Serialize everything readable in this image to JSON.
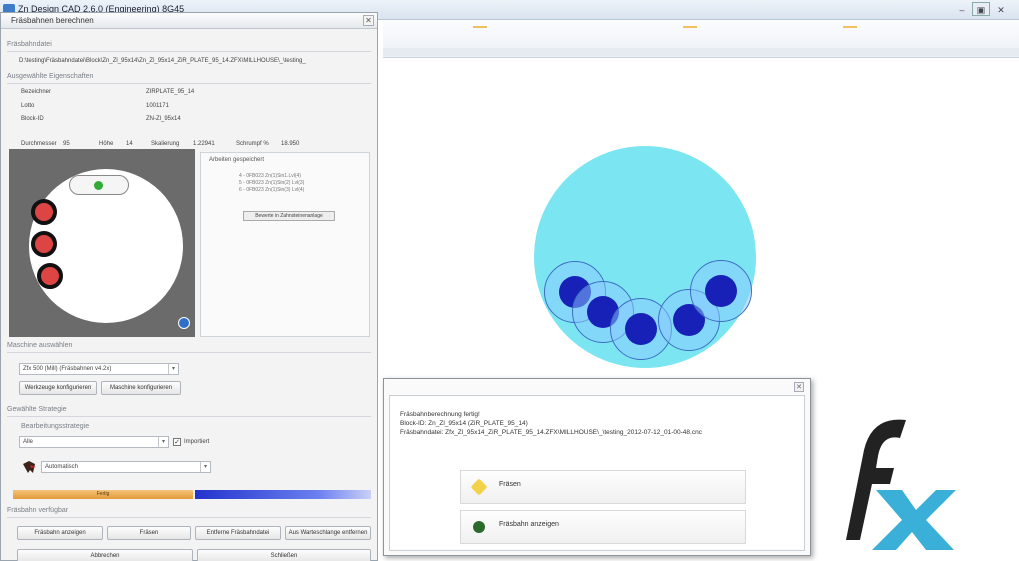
{
  "window": {
    "title": "Zn Design CAD 2.6.0 (Engineering) 8G45",
    "min": "–",
    "max": "▣",
    "close": "✕"
  },
  "dialog": {
    "title": "Fräsbahnen berechnen",
    "close": "✕",
    "section_file": "Fräsbahndatei",
    "path": "D:\\testing\\Fräsbahndatei\\Block\\Zn_Zl_95x14\\Zn_Zl_95x14_ZiR_PLATE_95_14.ZFX\\MILLHOUSE\\_\\testing_",
    "section_props": "Ausgewählte Eigenschaften",
    "props": [
      {
        "label": "Bezeichner",
        "value": "ZIRPLATE_95_14"
      },
      {
        "label": "Lotto",
        "value": "1001171"
      },
      {
        "label": "Block-ID",
        "value": "ZN-Zl_95x14"
      }
    ],
    "dims": {
      "durchmesser_label": "Durchmesser",
      "durchmesser_value": "95",
      "hoehe_label": "Höhe",
      "hoehe_value": "14",
      "skalierung_label": "Skalierung",
      "skalierung_value": "1.22941",
      "schrumpf_label": "Schrumpf %",
      "schrumpf_value": "18.950"
    },
    "list_head": "Arbeiten gespeichert",
    "list_items": [
      "4 - 0FB023 Zn(1)Sin1.Lvl(4)",
      "5 - 0FB023 Zn(1)Sin(2) Lvl(3)",
      "6 - 0FB023 Zn(1)Sin(3) Lvl(4)"
    ],
    "list_button": "Bewerte in Zahnsteinenanlage",
    "section_machine": "Maschine auswählen",
    "machine_combo": "Zfx 500 (Mill) (Fräsbahnen v4.2x)",
    "btn_config1": "Werkzeuge konfigurieren",
    "btn_config2": "Maschine konfigurieren",
    "section_strategy": "Gewählte Strategie",
    "strategy_label": "Bearbeitungsstrategie",
    "strategy_combo": "Alle",
    "checkbox_label": "Importiert",
    "auto_combo": "Automatisch",
    "progress_label": "Fertig",
    "section_buttons": "Fräsbahn verfügbar",
    "buttons": [
      "Fräsbahn anzeigen",
      "Fräsen",
      "Entferne Fräsbahndatei",
      "Aus Warteschlange entfernen"
    ],
    "bottom_buttons": [
      "Abbrechen",
      "Schließen"
    ]
  },
  "status_dialog": {
    "close": "✕",
    "line1": "Fräsbahnberechnung fertig!",
    "line2": "Block-ID: Zn_Zl_95x14 (ZiR_PLATE_95_14)",
    "line3": "Fräsbahndatei: Zfx_Zl_95x14_ZiR_PLATE_95_14.ZFX\\MILLHOUSE\\_\\testing_2012-07-12_01-00-48.cnc",
    "btn_mill": "Fräsen",
    "btn_show": "Fräsbahn anzeigen"
  },
  "colors": {
    "accent": "#3d7cc9",
    "cylinder": "#7be6f1",
    "core": "#1721b8",
    "progress_orange": "#e39a3a",
    "progress_blue": "#2233cc"
  },
  "logo": {
    "text": "fx"
  }
}
